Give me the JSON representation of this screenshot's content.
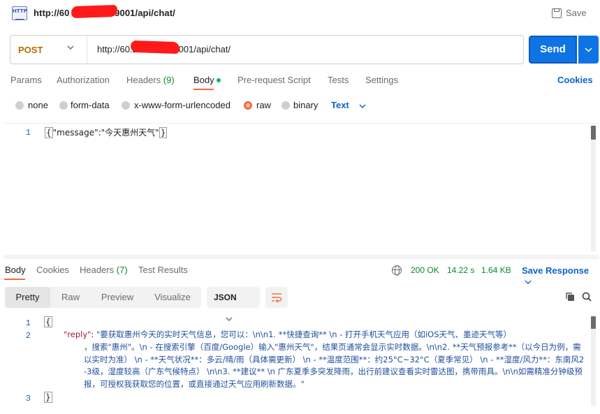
{
  "title": {
    "url": "http://60.██████.9001/api/chat/",
    "url_prefix": "http://60",
    "url_suffix": ".9001/api/chat/",
    "save_label": "Save"
  },
  "request": {
    "method": "POST",
    "url_prefix": "http://60.2",
    "url_suffix": ".9001/api/chat/",
    "send_label": "Send"
  },
  "request_tabs": [
    {
      "label": "Params"
    },
    {
      "label": "Authorization"
    },
    {
      "label": "Headers",
      "count": "(9)"
    },
    {
      "label": "Body"
    },
    {
      "label": "Pre-request Script"
    },
    {
      "label": "Tests"
    },
    {
      "label": "Settings"
    }
  ],
  "cookies_label": "Cookies",
  "body_types": [
    "none",
    "form-data",
    "x-www-form-urlencoded",
    "raw",
    "binary"
  ],
  "body_format": "Text",
  "request_body": {
    "line_no": "1",
    "open": "{",
    "content": "\"message\":\"今天惠州天气\"",
    "close": "}"
  },
  "response_tabs": [
    {
      "label": "Body"
    },
    {
      "label": "Cookies"
    },
    {
      "label": "Headers",
      "count": "(7)"
    },
    {
      "label": "Test Results"
    }
  ],
  "response_status": {
    "status": "200 OK",
    "time": "14.22 s",
    "size": "1.64 KB",
    "save_label": "Save Response"
  },
  "view_modes": [
    "Pretty",
    "Raw",
    "Preview",
    "Visualize"
  ],
  "view_format": "JSON",
  "response_body": {
    "line_numbers": [
      "1",
      "2",
      "3"
    ],
    "open": "{",
    "key": "\"reply\"",
    "colon": ": ",
    "value_line1": "\"要获取惠州今天的实时天气信息，您可以：\\n\\n1. **快捷查询**  \\n   - 打开手机天气应用（如iOS天气、墨迹天气等）",
    "value_rest": "，搜索\"惠州\"。\\n   - 在搜索引擎（百度/Google）输入\"惠州天气\"，结果页通常会显示实时数据。\\n\\n2. **天气预报参考**（以今日为例，需以实时为准）  \\n   - **天气状况**：多云/晴/雨（具体需更新）  \\n   - **温度范围**：约25°C~32°C（夏季常见）  \\n   - **湿度/风力**：东南风2-3级，湿度较高（广东气候特点）  \\n\\n3. **建议**  \\n   广东夏季多突发降雨，出行前建议查看实时雷达图，携带雨具。\\n\\n如需精准分钟级预报，可授权我获取您的位置，或直接通过天气应用刷新数据。\"",
    "close": "}"
  }
}
